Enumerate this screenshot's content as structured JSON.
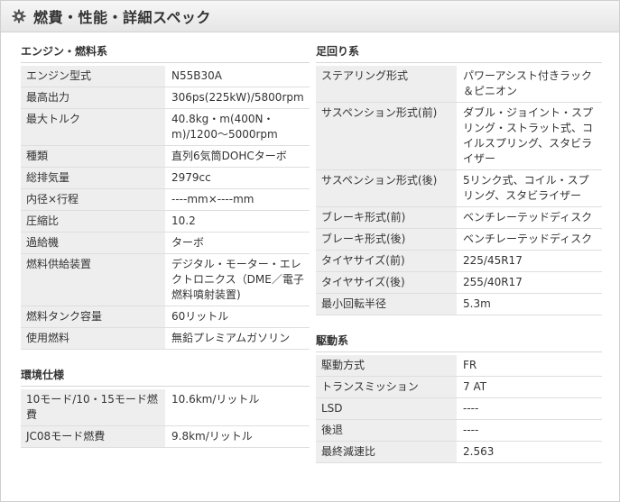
{
  "header": {
    "title": "燃費・性能・詳細スペック",
    "icon": "gear-icon"
  },
  "left": {
    "engine": {
      "title": "エンジン・燃料系",
      "rows": [
        {
          "label": "エンジン型式",
          "value": "N55B30A"
        },
        {
          "label": "最高出力",
          "value": "306ps(225kW)/5800rpm"
        },
        {
          "label": "最大トルク",
          "value": "40.8kg・m(400N・m)/1200〜5000rpm"
        },
        {
          "label": "種類",
          "value": "直列6気筒DOHCターボ"
        },
        {
          "label": "総排気量",
          "value": "2979cc"
        },
        {
          "label": "内径×行程",
          "value": "----mm×----mm"
        },
        {
          "label": "圧縮比",
          "value": "10.2"
        },
        {
          "label": "過給機",
          "value": "ターボ"
        },
        {
          "label": "燃料供給装置",
          "value": "デジタル・モーター・エレクトロニクス（DME／電子燃料噴射装置)"
        },
        {
          "label": "燃料タンク容量",
          "value": "60リットル"
        },
        {
          "label": "使用燃料",
          "value": "無鉛プレミアムガソリン"
        }
      ]
    },
    "environment": {
      "title": "環境仕様",
      "rows": [
        {
          "label": "10モード/10・15モード燃費",
          "value": "10.6km/リットル"
        },
        {
          "label": "JC08モード燃費",
          "value": "9.8km/リットル"
        }
      ]
    }
  },
  "right": {
    "suspension": {
      "title": "足回り系",
      "rows": [
        {
          "label": "ステアリング形式",
          "value": "パワーアシスト付きラック＆ピニオン"
        },
        {
          "label": "サスペンション形式(前)",
          "value": "ダブル・ジョイント・スプリング・ストラット式、コイルスプリング、スタビライザー"
        },
        {
          "label": "サスペンション形式(後)",
          "value": "5リンク式、コイル・スプリング、スタビライザー"
        },
        {
          "label": "ブレーキ形式(前)",
          "value": "ベンチレーテッドディスク"
        },
        {
          "label": "ブレーキ形式(後)",
          "value": "ベンチレーテッドディスク"
        },
        {
          "label": "タイヤサイズ(前)",
          "value": "225/45R17"
        },
        {
          "label": "タイヤサイズ(後)",
          "value": "255/40R17"
        },
        {
          "label": "最小回転半径",
          "value": "5.3m"
        }
      ]
    },
    "drive": {
      "title": "駆動系",
      "rows": [
        {
          "label": "駆動方式",
          "value": "FR"
        },
        {
          "label": "トランスミッション",
          "value": "7 AT"
        },
        {
          "label": "LSD",
          "value": "----"
        },
        {
          "label": "後退",
          "value": "----"
        },
        {
          "label": "最終減速比",
          "value": "2.563"
        }
      ]
    }
  }
}
